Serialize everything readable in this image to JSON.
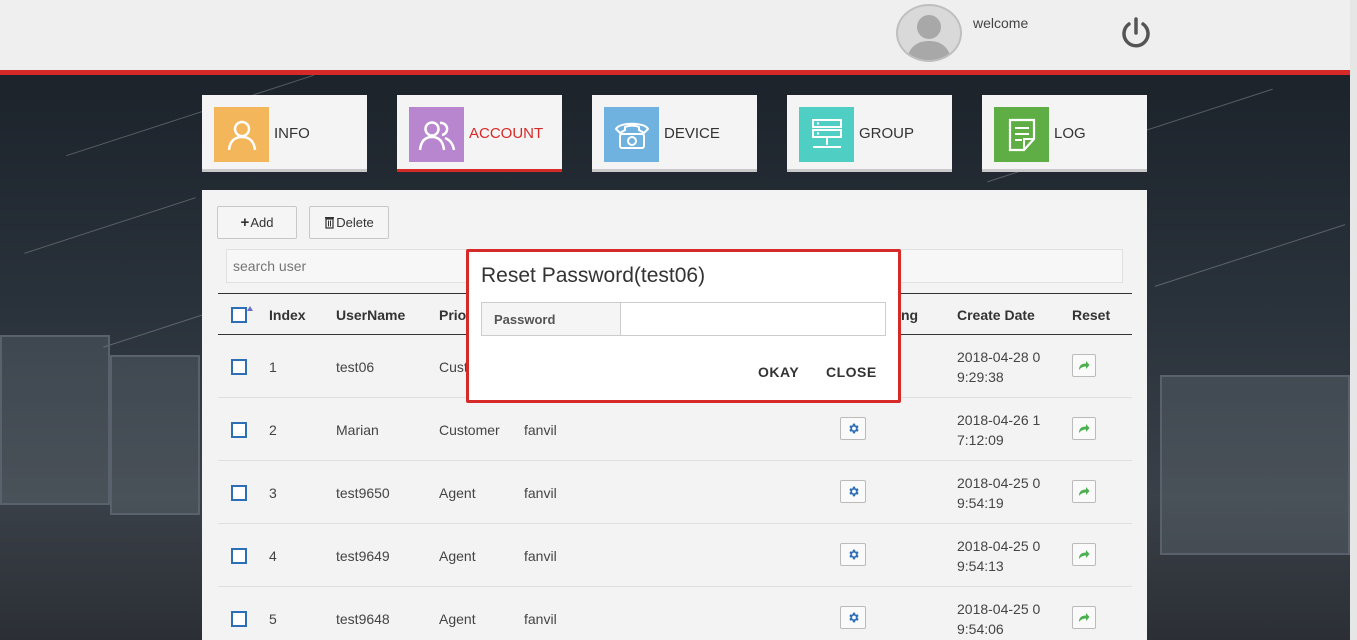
{
  "header": {
    "welcome_text": "welcome"
  },
  "nav": {
    "tiles": [
      {
        "label": "INFO",
        "color": "#f4b65a"
      },
      {
        "label": "ACCOUNT",
        "color": "#b886cf"
      },
      {
        "label": "DEVICE",
        "color": "#6fb2df"
      },
      {
        "label": "GROUP",
        "color": "#4fcfc4"
      },
      {
        "label": "LOG",
        "color": "#5eae45"
      }
    ],
    "active": "ACCOUNT"
  },
  "toolbar": {
    "add_label": "Add",
    "delete_label": "Delete"
  },
  "search": {
    "placeholder": "search user"
  },
  "table": {
    "headers": {
      "index": "Index",
      "username": "UserName",
      "priority": "Prio",
      "setting": "ng",
      "create_date": "Create Date",
      "reset": "Reset"
    },
    "rows": [
      {
        "index": "1",
        "username": "test06",
        "priority": "Cust",
        "group": "",
        "date_line1": "2018-04-28 0",
        "date_line2": "9:29:38"
      },
      {
        "index": "2",
        "username": "Marian",
        "priority": "Customer",
        "group": "fanvil",
        "date_line1": "2018-04-26 1",
        "date_line2": "7:12:09"
      },
      {
        "index": "3",
        "username": "test9650",
        "priority": "Agent",
        "group": "fanvil",
        "date_line1": "2018-04-25 0",
        "date_line2": "9:54:19"
      },
      {
        "index": "4",
        "username": "test9649",
        "priority": "Agent",
        "group": "fanvil",
        "date_line1": "2018-04-25 0",
        "date_line2": "9:54:13"
      },
      {
        "index": "5",
        "username": "test9648",
        "priority": "Agent",
        "group": "fanvil",
        "date_line1": "2018-04-25 0",
        "date_line2": "9:54:06"
      }
    ]
  },
  "modal": {
    "title": "Reset Password(test06)",
    "password_label": "Password",
    "password_value": "",
    "okay_label": "OKAY",
    "close_label": "CLOSE"
  },
  "colors": {
    "accent": "#d52a27",
    "checkbox": "#2d6fb6",
    "reset_arrow": "#4caf50"
  }
}
